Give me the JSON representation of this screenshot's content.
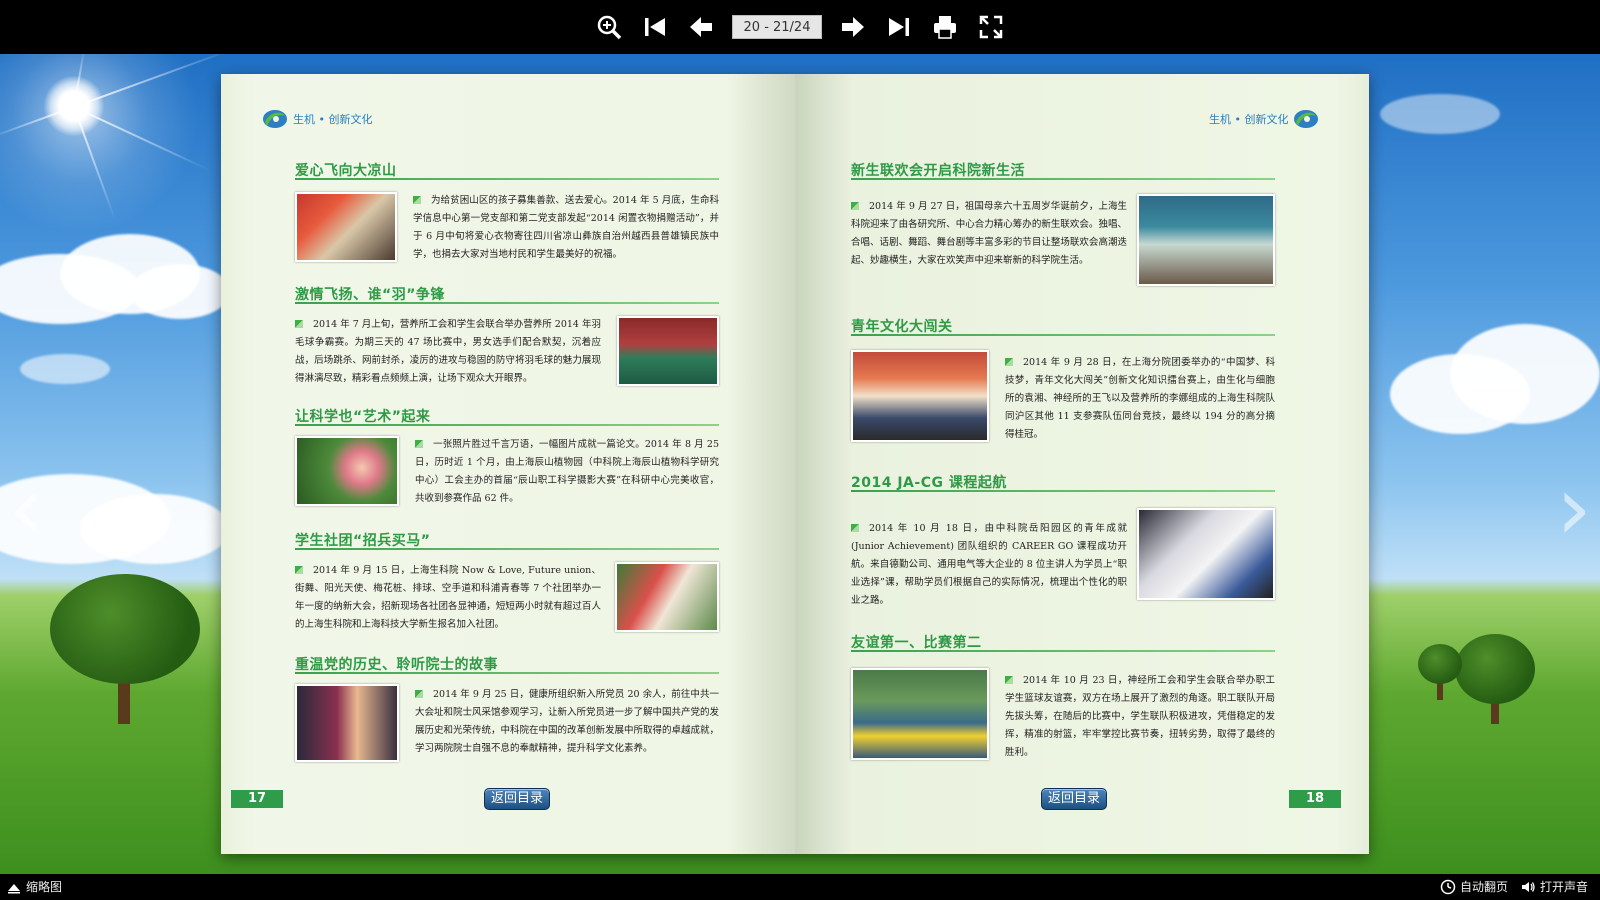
{
  "toolbar": {
    "page_indicator": "20 - 21/24",
    "buttons": [
      "zoom-in-icon",
      "first-page-icon",
      "previous-page-icon",
      "next-page-icon",
      "last-page-icon",
      "print-icon",
      "fullscreen-icon"
    ]
  },
  "brand": {
    "text": "生机 • 创新文化"
  },
  "left_page": {
    "number": "17",
    "return_label": "返回目录",
    "sections": [
      {
        "title": "爱心飞向大凉山",
        "text": "为给贫困山区的孩子募集善款、送去爱心。2014 年 5 月底，生命科学信息中心第一党支部和第二党支部发起“2014 闲置衣物捐赠活动”，并于 6 月中旬将爱心衣物寄往四川省凉山彝族自治州越西县普雄镇民族中学，也捐去大家对当地村民和学生最美好的祝福。"
      },
      {
        "title": "激情飞扬、谁“羽”争锋",
        "text": "2014 年 7 月上旬，营养所工会和学生会联合举办营养所 2014 年羽毛球争霸赛。为期三天的 47 场比赛中，男女选手们配合默契，沉着应战，后场跳杀、网前封杀，凌厉的进攻与稳固的防守将羽毛球的魅力展现得淋漓尽致，精彩看点频频上演，让场下观众大开眼界。"
      },
      {
        "title": "让科学也“艺术”起来",
        "text": "一张照片胜过千言万语，一幅图片成就一篇论文。2014 年 8 月 25 日，历时近 1 个月，由上海辰山植物园（中科院上海辰山植物科学研究中心）工会主办的首届“辰山职工科学摄影大赛”在科研中心完美收官，共收到参赛作品 62 件。"
      },
      {
        "title": "学生社团“招兵买马”",
        "text": "2014 年 9 月 15 日，上海生科院 Now & Love, Future union、街舞、阳光天使、梅花桩、排球、空手道和科浦青春等 7 个社团举办一年一度的纳新大会，招新现场各社团各显神通，短短两小时就有超过百人的上海生科院和上海科技大学新生报名加入社团。"
      },
      {
        "title": "重温党的历史、聆听院士的故事",
        "text": "2014 年 9 月 25 日，健康所组织新入所党员 20 余人，前往中共一大会址和院士风采馆参观学习，让新入所党员进一步了解中国共产党的发展历史和光荣传统，中科院在中国的改革创新发展中所取得的卓越成就，学习两院院士自强不息的奉献精神，提升科学文化素养。"
      }
    ]
  },
  "right_page": {
    "number": "18",
    "return_label": "返回目录",
    "sections": [
      {
        "title": "新生联欢会开启科院新生活",
        "text": "2014 年 9 月 27 日，祖国母亲六十五周岁华诞前夕，上海生科院迎来了由各研究所、中心合力精心筹办的新生联欢会。独唱、合唱、话剧、舞蹈、舞台剧等丰富多彩的节目让整场联欢会高潮迭起、妙趣横生，大家在欢笑声中迎来崭新的科学院生活。"
      },
      {
        "title": "青年文化大闯关",
        "text": "2014 年 9 月 28 日，在上海分院团委举办的“中国梦、科技梦，青年文化大闯关”创新文化知识擂台赛上，由生化与细胞所的袁湘、神经所的王飞以及营养所的李娜组成的上海生科院队同沪区其他 11 支参赛队伍同台竞技，最终以 194 分的高分摘得桂冠。"
      },
      {
        "title": "2014 JA-CG 课程起航",
        "text": "2014 年 10 月 18 日，由中科院岳阳园区的青年成就 (Junior Achievement) 团队组织的 CAREER GO 课程成功开航。来自德勤公司、通用电气等大企业的 8 位主讲人为学员上“职业选择”课，帮助学员们根据自己的实际情况，梳理出个性化的职业之路。"
      },
      {
        "title": "友谊第一、比赛第二",
        "text": "2014 年 10 月 23 日，神经所工会和学生会联合举办职工学生篮球友谊赛，双方在场上展开了激烈的角逐。职工联队开局先拔头筹，在随后的比赛中，学生联队积极进攻，凭借稳定的发挥，精准的射篮，牢牢掌控比赛节奏，扭转劣势，取得了最终的胜利。"
      }
    ]
  },
  "bottombar": {
    "thumbnails_label": "缩略图",
    "autoflip_label": "自动翻页",
    "sound_label": "打开声音"
  },
  "colors": {
    "accent_green": "#2e9a46",
    "brand_blue": "#2b7fc2",
    "toolbar_bg": "#000000"
  }
}
